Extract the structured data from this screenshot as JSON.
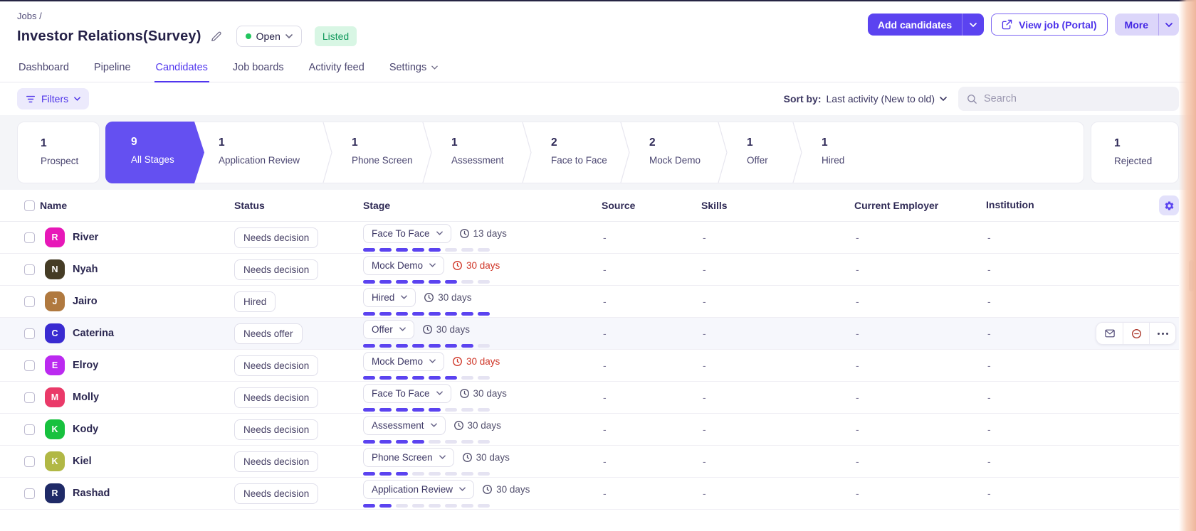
{
  "breadcrumb": {
    "label": "Jobs /"
  },
  "job_header": {
    "title": "Investor Relations(Survey)",
    "status_pill": {
      "label": "Open",
      "dot_color": "#22c55e"
    },
    "listed_badge": "Listed",
    "actions": {
      "add_candidates": "Add candidates",
      "view_job": "View job (Portal)",
      "more": "More"
    }
  },
  "tabs": [
    {
      "label": "Dashboard",
      "active": false
    },
    {
      "label": "Pipeline",
      "active": false
    },
    {
      "label": "Candidates",
      "active": true
    },
    {
      "label": "Job boards",
      "active": false
    },
    {
      "label": "Activity feed",
      "active": false
    },
    {
      "label": "Settings",
      "active": false,
      "has_chevron": true
    }
  ],
  "toolbar": {
    "filters_label": "Filters",
    "sort_by_label": "Sort by:",
    "sort_by_value": "Last activity (New to old)",
    "search_placeholder": "Search"
  },
  "pipeline_stages": {
    "prospect": {
      "count": "1",
      "label": "Prospect"
    },
    "strip": [
      {
        "count": "9",
        "label": "All Stages",
        "selected": true
      },
      {
        "count": "1",
        "label": "Application Review"
      },
      {
        "count": "1",
        "label": "Phone Screen"
      },
      {
        "count": "1",
        "label": "Assessment"
      },
      {
        "count": "2",
        "label": "Face to Face"
      },
      {
        "count": "2",
        "label": "Mock Demo"
      },
      {
        "count": "1",
        "label": "Offer"
      },
      {
        "count": "1",
        "label": "Hired"
      }
    ],
    "rejected": {
      "count": "1",
      "label": "Rejected"
    }
  },
  "table": {
    "columns": [
      "Name",
      "Status",
      "Stage",
      "Source",
      "Skills",
      "Current Employer",
      "Institution"
    ],
    "progress_total": 8,
    "rows": [
      {
        "name": "River",
        "initial": "R",
        "avatar_color": "#e718b8",
        "status": "Needs decision",
        "stage": "Face To Face",
        "days": "13 days",
        "overdue": false,
        "progress": 5,
        "source": "-",
        "skills": "-",
        "employer": "-",
        "institution": "-",
        "highlighted": false
      },
      {
        "name": "Nyah",
        "initial": "N",
        "avatar_color": "#453c25",
        "status": "Needs decision",
        "stage": "Mock Demo",
        "days": "30 days",
        "overdue": true,
        "progress": 6,
        "source": "-",
        "skills": "-",
        "employer": "-",
        "institution": "-",
        "highlighted": false
      },
      {
        "name": "Jairo",
        "initial": "J",
        "avatar_color": "#b0793f",
        "status": "Hired",
        "stage": "Hired",
        "days": "30 days",
        "overdue": false,
        "progress": 8,
        "source": "-",
        "skills": "-",
        "employer": "-",
        "institution": "-",
        "highlighted": false
      },
      {
        "name": "Caterina",
        "initial": "C",
        "avatar_color": "#3a2bd1",
        "status": "Needs offer",
        "stage": "Offer",
        "days": "30 days",
        "overdue": false,
        "progress": 7,
        "source": "-",
        "skills": "-",
        "employer": "-",
        "institution": "-",
        "highlighted": true,
        "row_actions": [
          "email",
          "disqualify",
          "more"
        ]
      },
      {
        "name": "Elroy",
        "initial": "E",
        "avatar_color": "#bb2af0",
        "status": "Needs decision",
        "stage": "Mock Demo",
        "days": "30 days",
        "overdue": true,
        "progress": 6,
        "source": "-",
        "skills": "-",
        "employer": "-",
        "institution": "-",
        "highlighted": false
      },
      {
        "name": "Molly",
        "initial": "M",
        "avatar_color": "#ea3a69",
        "status": "Needs decision",
        "stage": "Face To Face",
        "days": "30 days",
        "overdue": false,
        "progress": 5,
        "source": "-",
        "skills": "-",
        "employer": "-",
        "institution": "-",
        "highlighted": false
      },
      {
        "name": "Kody",
        "initial": "K",
        "avatar_color": "#17c13e",
        "status": "Needs decision",
        "stage": "Assessment",
        "days": "30 days",
        "overdue": false,
        "progress": 4,
        "source": "-",
        "skills": "-",
        "employer": "-",
        "institution": "-",
        "highlighted": false
      },
      {
        "name": "Kiel",
        "initial": "K",
        "avatar_color": "#b1b845",
        "status": "Needs decision",
        "stage": "Phone Screen",
        "days": "30 days",
        "overdue": false,
        "progress": 3,
        "source": "-",
        "skills": "-",
        "employer": "-",
        "institution": "-",
        "highlighted": false
      },
      {
        "name": "Rashad",
        "initial": "R",
        "avatar_color": "#1f2a67",
        "status": "Needs decision",
        "stage": "Application Review",
        "days": "30 days",
        "overdue": false,
        "progress": 2,
        "source": "-",
        "skills": "-",
        "employer": "-",
        "institution": "-",
        "highlighted": false
      }
    ]
  },
  "colors": {
    "primary": "#5b43f0",
    "selected_stage": "#6450f1",
    "overdue_red": "#cf3426",
    "listed_bg": "#d8f6e4",
    "listed_text": "#149a5e",
    "progress_filled": "#5b43f0",
    "progress_empty": "#e5e3f2"
  }
}
